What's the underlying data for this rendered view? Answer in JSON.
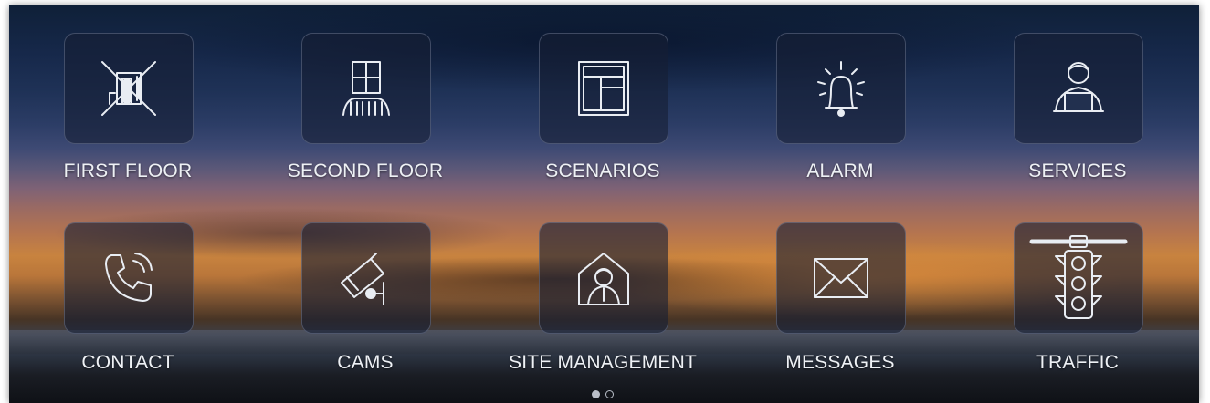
{
  "menu": {
    "items": [
      {
        "label": "FIRST FLOOR",
        "icon": "room-icon"
      },
      {
        "label": "SECOND FLOOR",
        "icon": "balcony-window-icon"
      },
      {
        "label": "SCENARIOS",
        "icon": "layout-icon"
      },
      {
        "label": "ALARM",
        "icon": "alarm-bell-icon"
      },
      {
        "label": "SERVICES",
        "icon": "person-laptop-icon"
      },
      {
        "label": "CONTACT",
        "icon": "phone-icon"
      },
      {
        "label": "CAMS",
        "icon": "security-camera-icon"
      },
      {
        "label": "SITE MANAGEMENT",
        "icon": "house-person-icon"
      },
      {
        "label": "MESSAGES",
        "icon": "envelope-icon"
      },
      {
        "label": "TRAFFIC",
        "icon": "traffic-light-icon"
      }
    ]
  },
  "pagination": {
    "pages": 2,
    "current": 1
  },
  "colors": {
    "icon_stroke": "#e9edf3",
    "label_text": "#eef1f5",
    "tile_border": "#9aa0b9"
  }
}
